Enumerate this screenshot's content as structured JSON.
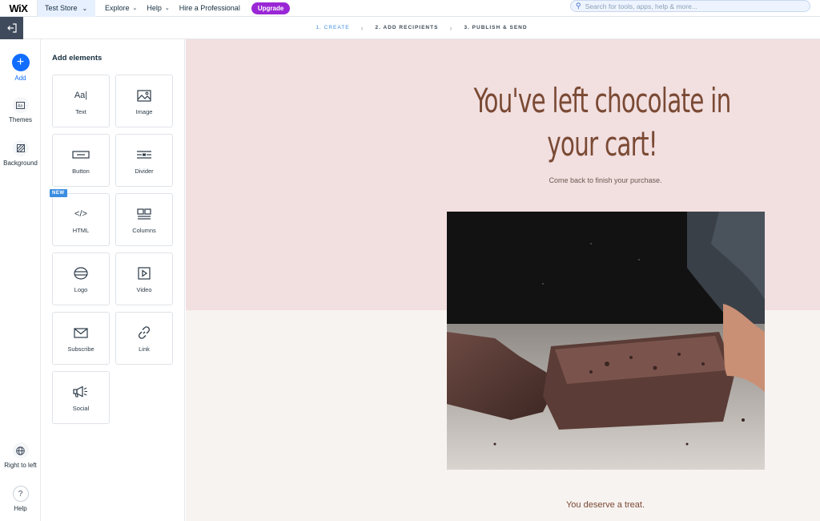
{
  "topbar": {
    "logo": "WiX",
    "site_name": "Test Store",
    "menu": [
      "Explore",
      "Help",
      "Hire a Professional"
    ],
    "upgrade_label": "Upgrade",
    "search_placeholder": "Search for tools, apps, help & more..."
  },
  "steps": {
    "step1": "1. CREATE",
    "step2": "2. ADD RECIPIENTS",
    "step3": "3. PUBLISH & SEND"
  },
  "rail": {
    "add": "Add",
    "themes": "Themes",
    "background": "Background",
    "rtl": "Right to left",
    "help": "Help"
  },
  "panel": {
    "title": "Add elements",
    "new_badge": "NEW",
    "tiles": {
      "text": "Text",
      "image": "Image",
      "button": "Button",
      "divider": "Divider",
      "html": "HTML",
      "columns": "Columns",
      "logo": "Logo",
      "video": "Video",
      "subscribe": "Subscribe",
      "link": "Link",
      "social": "Social"
    },
    "icons": {
      "text_glyph": "Aa|",
      "html_glyph": "</>"
    }
  },
  "canvas": {
    "headline": "You've left chocolate in your cart!",
    "subline": "Come back to finish your purchase.",
    "footer": "You deserve a treat."
  },
  "colors": {
    "accent": "#116dff",
    "upgrade": "#9a27d5",
    "headline": "#7a4a34",
    "pink_bg": "#f2dfe0"
  }
}
